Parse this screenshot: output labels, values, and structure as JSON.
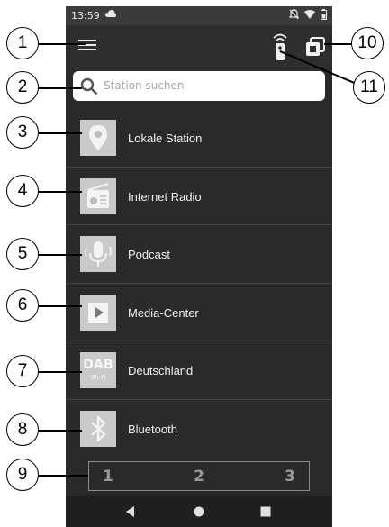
{
  "status_bar": {
    "time": "13:59"
  },
  "search": {
    "placeholder": "Station suchen"
  },
  "menu": {
    "items": [
      {
        "id": "local",
        "label": "Lokale Station",
        "icon": "location-pin-icon"
      },
      {
        "id": "internet-radio",
        "label": "Internet Radio",
        "icon": "radio-icon"
      },
      {
        "id": "podcast",
        "label": "Podcast",
        "icon": "microphone-icon"
      },
      {
        "id": "media-center",
        "label": "Media-Center",
        "icon": "play-icon"
      },
      {
        "id": "dab",
        "label": "Deutschland",
        "icon": "dab-wifi-icon",
        "icon_text": "DAB",
        "icon_subtext": "Wi-Fi"
      },
      {
        "id": "bluetooth",
        "label": "Bluetooth",
        "icon": "bluetooth-icon"
      }
    ]
  },
  "presets": [
    "1",
    "2",
    "3"
  ],
  "callouts": [
    "1",
    "2",
    "3",
    "4",
    "5",
    "6",
    "7",
    "8",
    "9",
    "10",
    "11"
  ],
  "colors": {
    "background": "#2a2a2a",
    "icon_tile": "#d0d0d0",
    "text": "#f0f0f0"
  }
}
